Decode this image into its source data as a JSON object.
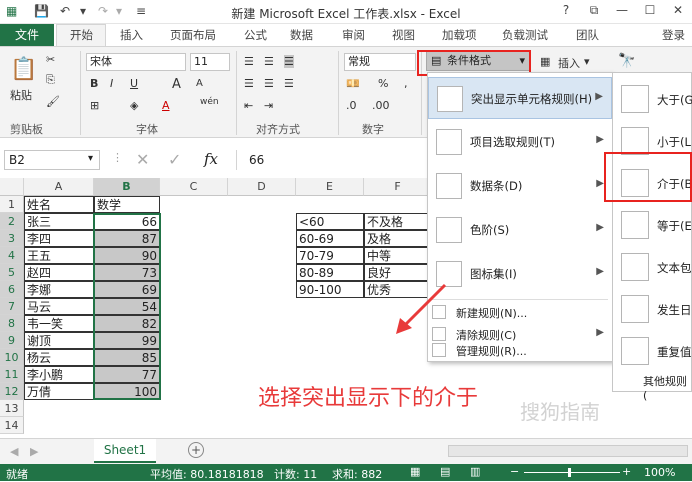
{
  "window": {
    "title": "新建 Microsoft Excel 工作表.xlsx - Excel",
    "help": "?",
    "login": "登录"
  },
  "tabs": [
    "文件",
    "开始",
    "插入",
    "页面布局",
    "公式",
    "数据",
    "审阅",
    "视图",
    "加载项",
    "负载测试",
    "团队"
  ],
  "ribbon": {
    "paste_label": "粘贴",
    "font_name": "宋体",
    "font_size": "11",
    "number_format": "常规",
    "conditional_format": "条件格式",
    "insert": "插入",
    "groups": [
      "剪贴板",
      "字体",
      "对齐方式",
      "数字"
    ],
    "bold": "B",
    "italic": "I",
    "underline": "U",
    "grow_font": "A",
    "shrink_font": "A",
    "font_color": "A",
    "wen": "wén",
    "percent": "%",
    "comma": ","
  },
  "formula_bar": {
    "name_box": "B2",
    "fx": "fx",
    "value": "66"
  },
  "columns": [
    "A",
    "B",
    "C",
    "D",
    "E",
    "F"
  ],
  "rows": [
    "1",
    "2",
    "3",
    "4",
    "5",
    "6",
    "7",
    "8",
    "9",
    "10",
    "11",
    "12",
    "13",
    "14"
  ],
  "col_a": [
    "姓名",
    "张三",
    "李四",
    "王五",
    "赵四",
    "李娜",
    "马云",
    "韦一笑",
    "谢顶",
    "杨云",
    "李小鹏",
    "万倩"
  ],
  "col_b": [
    "数学",
    "66",
    "87",
    "90",
    "73",
    "69",
    "54",
    "82",
    "99",
    "85",
    "77",
    "100"
  ],
  "col_e": [
    "<60",
    "60-69",
    "70-79",
    "80-89",
    "90-100"
  ],
  "col_f": [
    "不及格",
    "及格",
    "中等",
    "良好",
    "优秀"
  ],
  "menu": {
    "items": [
      {
        "label": "突出显示单元格规则(H)",
        "icon": "highlight-rules-icon"
      },
      {
        "label": "项目选取规则(T)",
        "icon": "top-bottom-rules-icon"
      },
      {
        "label": "数据条(D)",
        "icon": "data-bars-icon"
      },
      {
        "label": "色阶(S)",
        "icon": "color-scales-icon"
      },
      {
        "label": "图标集(I)",
        "icon": "icon-sets-icon"
      }
    ],
    "small_items": [
      "新建规则(N)...",
      "清除规则(C)",
      "管理规则(R)..."
    ]
  },
  "submenu": {
    "items": [
      "大于(G",
      "小于(L",
      "介于(B",
      "等于(E",
      "文本包",
      "发生日",
      "重复值"
    ],
    "footer": "其他规则("
  },
  "sheet": {
    "tab": "Sheet1",
    "add": "+"
  },
  "status": {
    "ready": "就绪",
    "average": "平均值: 80.18181818",
    "count": "计数: 11",
    "sum": "求和: 882",
    "zoom": "100%"
  },
  "annotation": "选择突出显示下的介于",
  "watermark": "搜狗指南",
  "colors": {
    "excel_green": "#217346",
    "highlight_red": "#e8231f",
    "annotation_red": "#e83a3a",
    "selection_gray": "#c8c8c8"
  }
}
